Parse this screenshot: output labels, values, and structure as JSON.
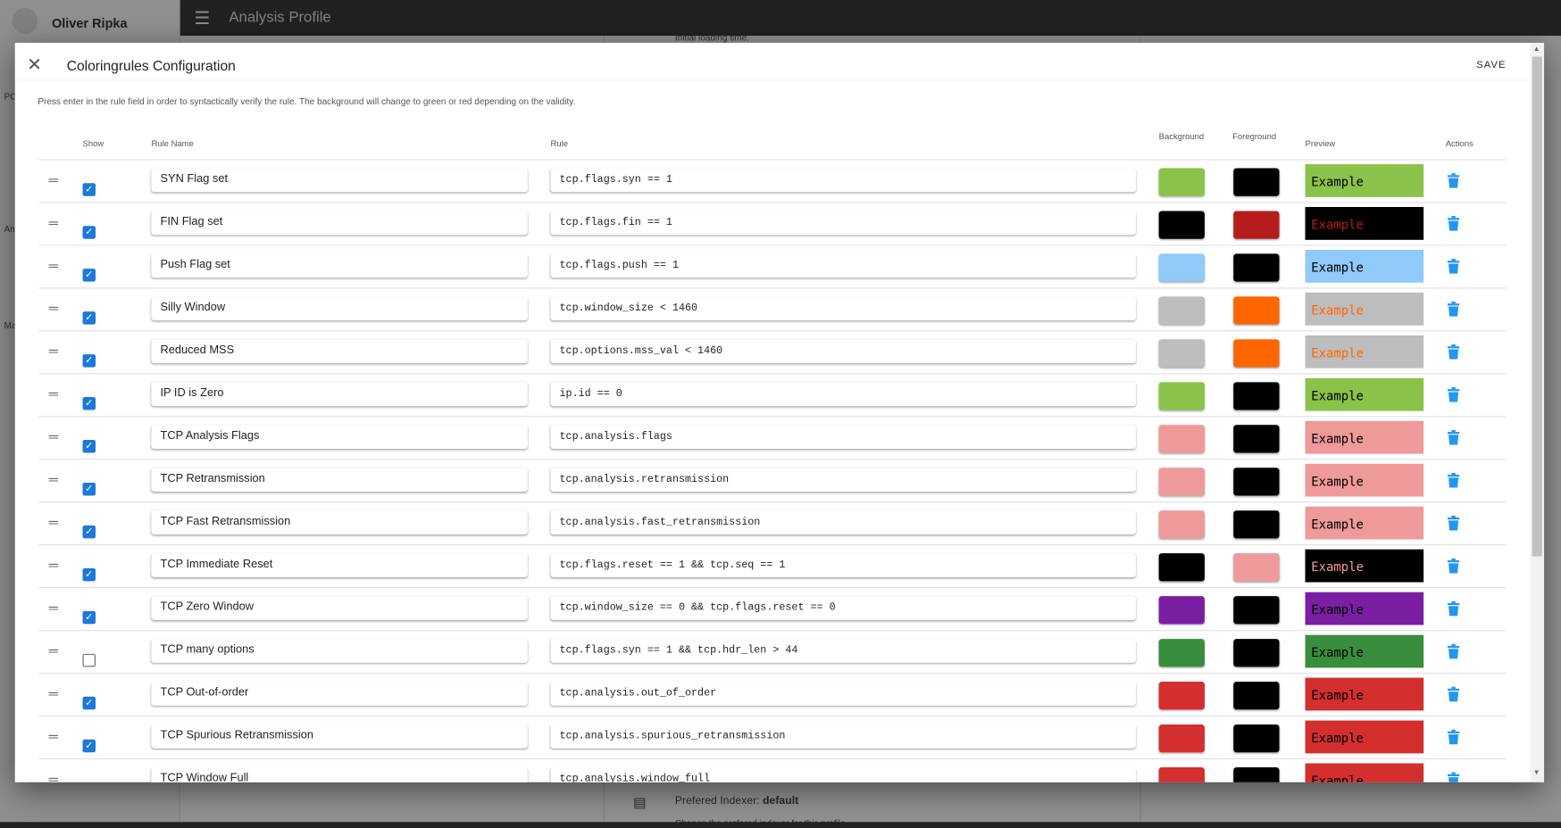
{
  "background": {
    "user_name": "Oliver Ripka",
    "app_title": "Analysis Profile",
    "sidebar_fragments": [
      "PC",
      "An",
      "Ma"
    ],
    "initial_loading_text": "Initial loading time.",
    "indexer_label": "Prefered Indexer:",
    "indexer_value": "default",
    "indexer_desc": "Change the prefered indexer for this profile"
  },
  "dialog": {
    "title": "Coloringrules Configuration",
    "save_label": "SAVE",
    "description": "Press enter in the rule field in order to syntactically verify the rule. The background will change to green or red depending on the validity.",
    "columns": {
      "show": "Show",
      "name": "Rule Name",
      "rule": "Rule",
      "background": "Background",
      "foreground": "Foreground",
      "preview": "Preview",
      "actions": "Actions"
    },
    "preview_text": "Example",
    "rules": [
      {
        "show": true,
        "name": "SYN Flag set",
        "rule": "tcp.flags.syn == 1",
        "bg": "#8bc34a",
        "fg": "#000000"
      },
      {
        "show": true,
        "name": "FIN Flag set",
        "rule": "tcp.flags.fin == 1",
        "bg": "#000000",
        "fg": "#b71c1c"
      },
      {
        "show": true,
        "name": "Push Flag set",
        "rule": "tcp.flags.push == 1",
        "bg": "#90caf9",
        "fg": "#000000"
      },
      {
        "show": true,
        "name": "Silly Window",
        "rule": "tcp.window_size < 1460",
        "bg": "#bdbdbd",
        "fg": "#ff6600"
      },
      {
        "show": true,
        "name": "Reduced MSS",
        "rule": "tcp.options.mss_val < 1460",
        "bg": "#bdbdbd",
        "fg": "#ff6600"
      },
      {
        "show": true,
        "name": "IP ID is Zero",
        "rule": "ip.id == 0",
        "bg": "#8bc34a",
        "fg": "#000000"
      },
      {
        "show": true,
        "name": "TCP Analysis Flags",
        "rule": "tcp.analysis.flags",
        "bg": "#ef9a9a",
        "fg": "#000000"
      },
      {
        "show": true,
        "name": "TCP Retransmission",
        "rule": "tcp.analysis.retransmission",
        "bg": "#ef9a9a",
        "fg": "#000000"
      },
      {
        "show": true,
        "name": "TCP Fast Retransmission",
        "rule": "tcp.analysis.fast_retransmission",
        "bg": "#ef9a9a",
        "fg": "#000000"
      },
      {
        "show": true,
        "name": "TCP Immediate Reset",
        "rule": "tcp.flags.reset == 1 && tcp.seq == 1",
        "bg": "#000000",
        "fg": "#ef9a9a"
      },
      {
        "show": true,
        "name": "TCP Zero Window",
        "rule": "tcp.window_size == 0 && tcp.flags.reset == 0",
        "bg": "#7b1fa2",
        "fg": "#000000"
      },
      {
        "show": false,
        "name": "TCP many options",
        "rule": "tcp.flags.syn == 1 && tcp.hdr_len > 44",
        "bg": "#388e3c",
        "fg": "#000000"
      },
      {
        "show": true,
        "name": "TCP Out-of-order",
        "rule": "tcp.analysis.out_of_order",
        "bg": "#d32f2f",
        "fg": "#000000"
      },
      {
        "show": true,
        "name": "TCP Spurious Retransmission",
        "rule": "tcp.analysis.spurious_retransmission",
        "bg": "#d32f2f",
        "fg": "#000000"
      },
      {
        "show": true,
        "name": "TCP Window Full",
        "rule": "tcp.analysis.window_full",
        "bg": "#d32f2f",
        "fg": "#000000"
      }
    ]
  },
  "colors": {
    "accent": "#1e78d7",
    "delete_icon": "#2196f3",
    "appbar": "#3a3a3a"
  }
}
